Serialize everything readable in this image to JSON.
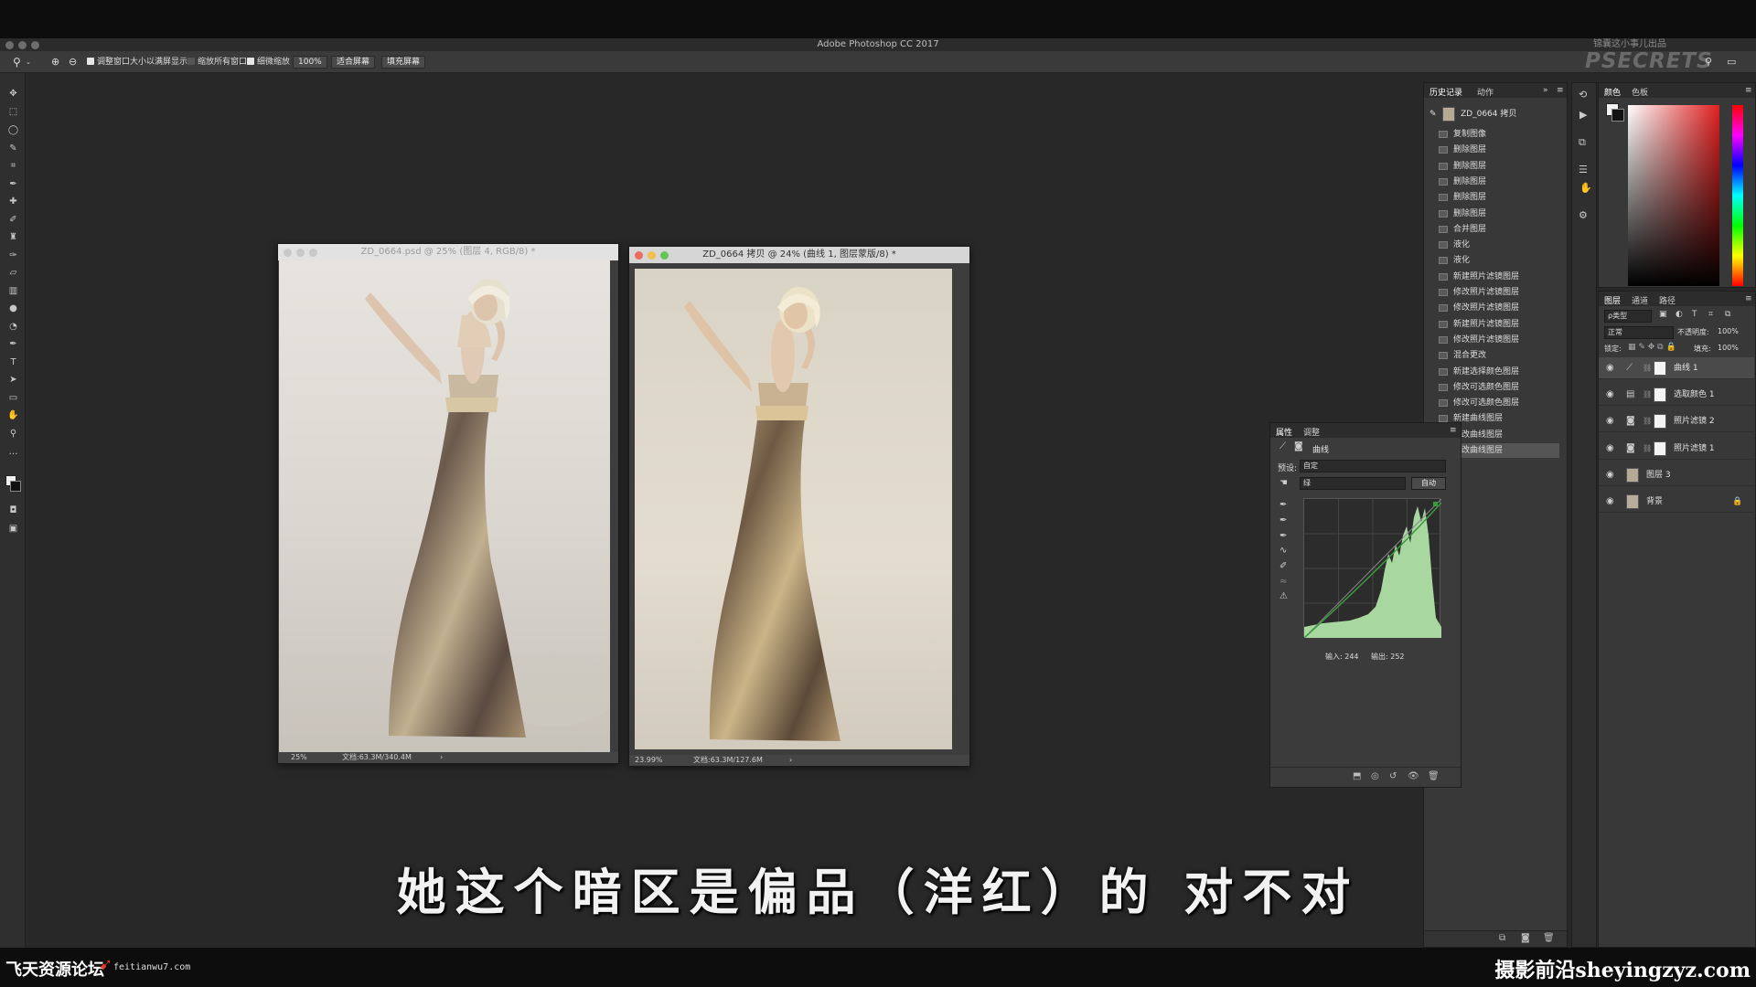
{
  "app": {
    "title": "Adobe Photoshop CC 2017",
    "watermark_top": "锦囊这小事儿出品",
    "watermark_brand": "PSECRETS"
  },
  "options_bar": {
    "resize_windows": "调整窗口大小以满屏显示",
    "zoom_all": "缩放所有窗口",
    "scrubby_zoom": "细微缩放",
    "zoom_level": "100%",
    "fit_screen": "适合屏幕",
    "fill_screen": "填充屏幕"
  },
  "documents": [
    {
      "title": "ZD_0664.psd @ 25% (图层 4, RGB/8) *",
      "zoom": "25%",
      "docsize": "文档:63.3M/340.4M"
    },
    {
      "title": "ZD_0664 拷贝 @ 24% (曲线 1, 图层蒙版/8) *",
      "zoom": "23.99%",
      "docsize": "文档:63.3M/127.6M"
    }
  ],
  "history_panel": {
    "tabs": [
      "历史记录",
      "动作"
    ],
    "snapshot": "ZD_0664 拷贝",
    "items": [
      "复制图像",
      "删除图层",
      "删除图层",
      "删除图层",
      "删除图层",
      "删除图层",
      "合并图层",
      "液化",
      "液化",
      "新建照片滤镜图层",
      "修改照片滤镜图层",
      "修改照片滤镜图层",
      "新建照片滤镜图层",
      "修改照片滤镜图层",
      "混合更改",
      "新建选择颜色图层",
      "修改可选颜色图层",
      "修改可选颜色图层",
      "新建曲线图层",
      "修改曲线图层",
      "修改曲线图层"
    ]
  },
  "properties_panel": {
    "tabs": [
      "属性",
      "调整"
    ],
    "type": "曲线",
    "preset_label": "预设:",
    "preset_value": "自定",
    "channel": "绿",
    "auto": "自动",
    "input": "输入: 244",
    "output": "输出: 252"
  },
  "color_panel": {
    "tabs": [
      "颜色",
      "色板"
    ]
  },
  "layers_panel": {
    "tabs": [
      "图层",
      "通道",
      "路径"
    ],
    "filter": "ρ类型",
    "blend": "正常",
    "opacity_label": "不透明度:",
    "opacity": "100%",
    "lock_label": "锁定:",
    "fill_label": "填充:",
    "fill": "100%",
    "layers": [
      "曲线 1",
      "选取颜色 1",
      "照片滤镜 2",
      "照片滤镜 1",
      "图层 3",
      "背景"
    ]
  },
  "subtitle": "她这个暗区是偏品（洋红）的 对不对",
  "footer": {
    "left_brand": "飞天资源论坛",
    "left_url": "feitianwu7.com",
    "right_brand": "摄影前沿sheyingzyz.com"
  }
}
